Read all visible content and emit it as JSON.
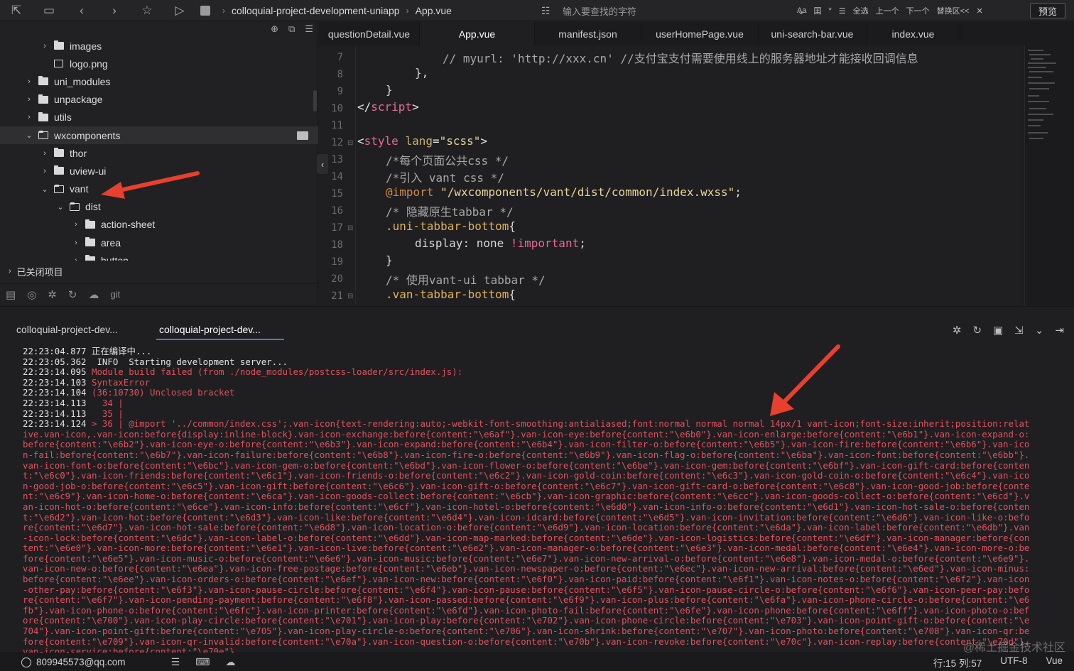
{
  "toolbar": {
    "breadcrumb": [
      "colloquial-project-development-uniapp",
      "App.vue"
    ],
    "search_placeholder": "输入要查找的字符",
    "find_tools": [
      "Aa",
      "囯",
      "*",
      "☰",
      "全选",
      "上一个",
      "下一个",
      "替换区<<",
      "✕"
    ],
    "preview": "预览"
  },
  "sidebar": {
    "tree": [
      {
        "label": "images",
        "depth": 2,
        "type": "folder",
        "expanded": false
      },
      {
        "label": "logo.png",
        "depth": 2,
        "type": "image",
        "expanded": false
      },
      {
        "label": "uni_modules",
        "depth": 1,
        "type": "folder",
        "expanded": false
      },
      {
        "label": "unpackage",
        "depth": 1,
        "type": "folder",
        "expanded": false
      },
      {
        "label": "utils",
        "depth": 1,
        "type": "folder",
        "expanded": false
      },
      {
        "label": "wxcomponents",
        "depth": 1,
        "type": "folder",
        "expanded": true,
        "selected": true
      },
      {
        "label": "thor",
        "depth": 2,
        "type": "folder",
        "expanded": false
      },
      {
        "label": "uview-ui",
        "depth": 2,
        "type": "folder",
        "expanded": false
      },
      {
        "label": "vant",
        "depth": 2,
        "type": "folder",
        "expanded": true
      },
      {
        "label": "dist",
        "depth": 3,
        "type": "folder",
        "expanded": true
      },
      {
        "label": "action-sheet",
        "depth": 4,
        "type": "folder",
        "expanded": false
      },
      {
        "label": "area",
        "depth": 4,
        "type": "folder",
        "expanded": false
      },
      {
        "label": "button",
        "depth": 4,
        "type": "folder",
        "expanded": false
      }
    ],
    "closed_projects": "已关闭项目",
    "bottom_icons": [
      "file-tree-icon",
      "binoculars-icon",
      "bug-icon",
      "sync-icon",
      "cloud-icon"
    ],
    "bottom_git": "git"
  },
  "tabs": [
    {
      "label": "questionDetail.vue",
      "active": false
    },
    {
      "label": "App.vue",
      "active": true
    },
    {
      "label": "manifest.json",
      "active": false
    },
    {
      "label": "userHomePage.vue",
      "active": false
    },
    {
      "label": "uni-search-bar.vue",
      "active": false
    },
    {
      "label": "index.vue",
      "active": false
    }
  ],
  "editor": {
    "lines": [
      {
        "n": "7",
        "fold": false
      },
      {
        "n": "8",
        "fold": false
      },
      {
        "n": "9",
        "fold": false
      },
      {
        "n": "10",
        "fold": false
      },
      {
        "n": "11",
        "fold": false
      },
      {
        "n": "12",
        "fold": true
      },
      {
        "n": "13",
        "fold": false
      },
      {
        "n": "14",
        "fold": false
      },
      {
        "n": "15",
        "fold": false
      },
      {
        "n": "16",
        "fold": false
      },
      {
        "n": "17",
        "fold": true
      },
      {
        "n": "18",
        "fold": false
      },
      {
        "n": "19",
        "fold": false
      },
      {
        "n": "20",
        "fold": false
      },
      {
        "n": "21",
        "fold": true
      }
    ],
    "code": {
      "l7": "// myurl: 'http://xxx.cn' //支付宝支付需要使用线上的服务器地址才能接收回调信息",
      "l8": "},",
      "l9": "}",
      "l10_open": "</",
      "l10_tag": "script",
      "l10_close": ">",
      "l12_open": "<",
      "l12_tag": "style",
      "l12_attr": " lang",
      "l12_eq": "=",
      "l12_val": "\"scss\"",
      "l12_close": ">",
      "l13": "/*每个页面公共css */",
      "l14": "/*引入 vant css */",
      "l15_at": "@import",
      "l15_str": " \"/wxcomponents/vant/dist/common/index.wxss\"",
      "l15_end": ";",
      "l16": "/* 隐藏原生tabbar */",
      "l17_sel": ".uni-tabbar-bottom",
      "l17_brace": "{",
      "l18_prop": "display",
      "l18_colon": ": none ",
      "l18_imp": "!important",
      "l18_end": ";",
      "l19": "}",
      "l20": "/* 使用vant-ui tabbar */",
      "l21_sel": ".van-tabbar-bottom",
      "l21_brace": "{"
    }
  },
  "console": {
    "tabs": [
      "colloquial-project-dev...",
      "colloquial-project-dev..."
    ],
    "active_tab": 1,
    "tool_icons": [
      "bug-icon",
      "restart-icon",
      "stop-icon",
      "export-icon",
      "chevron-down-icon",
      "close-split-icon"
    ],
    "logs": [
      {
        "ts": "22:23:04.877",
        "text": " 正在编译中...",
        "error": false
      },
      {
        "ts": "22:23:05.362",
        "text": "  INFO  Starting development server...",
        "error": false
      },
      {
        "ts": "22:23:14.095",
        "text": " Module build failed (from ./node_modules/postcss-loader/src/index.js):",
        "error": true
      },
      {
        "ts": "22:23:14.103",
        "text": " SyntaxError",
        "error": true
      },
      {
        "ts": "22:23:14.104",
        "text": " (36:10730) Unclosed bracket",
        "error": true
      },
      {
        "ts": "22:23:14.113",
        "text": "   34 |",
        "error": true
      },
      {
        "ts": "22:23:14.113",
        "text": "   35 |",
        "error": true
      }
    ],
    "dump_ts": "22:23:14.124",
    "dump": " > 36 | @import '../common/index.css';.van-icon{text-rendering:auto;-webkit-font-smoothing:antialiased;font:normal normal normal 14px/1 vant-icon;font-size:inherit;position:relative.van-icon,.van-icon:before{display:inline-block}.van-icon-exchange:before{content:\"\\e6af\"}.van-icon-eye:before{content:\"\\e6b0\"}.van-icon-enlarge:before{content:\"\\e6b1\"}.van-icon-expand-o:before{content:\"\\e6b2\"}.van-icon-eye-o:before{content:\"\\e6b3\"}.van-icon-expand:before{content:\"\\e6b4\"}.van-icon-filter-o:before{content:\"\\e6b5\"}.van-icon-fire:before{content:\"\\e6b6\"}.van-icon-fail:before{content:\"\\e6b7\"}.van-icon-failure:before{content:\"\\e6b8\"}.van-icon-fire-o:before{content:\"\\e6b9\"}.van-icon-flag-o:before{content:\"\\e6ba\"}.van-icon-font:before{content:\"\\e6bb\"}.van-icon-font-o:before{content:\"\\e6bc\"}.van-icon-gem-o:before{content:\"\\e6bd\"}.van-icon-flower-o:before{content:\"\\e6be\"}.van-icon-gem:before{content:\"\\e6bf\"}.van-icon-gift-card:before{content:\"\\e6c0\"}.van-icon-friends:before{content:\"\\e6c1\"}.van-icon-friends-o:before{content:\"\\e6c2\"}.van-icon-gold-coin:before{content:\"\\e6c3\"}.van-icon-gold-coin-o:before{content:\"\\e6c4\"}.van-icon-good-job-o:before{content:\"\\e6c5\"}.van-icon-gift:before{content:\"\\e6c6\"}.van-icon-gift-o:before{content:\"\\e6c7\"}.van-icon-gift-card-o:before{content:\"\\e6c8\"}.van-icon-good-job:before{content:\"\\e6c9\"}.van-icon-home-o:before{content:\"\\e6ca\"}.van-icon-goods-collect:before{content:\"\\e6cb\"}.van-icon-graphic:before{content:\"\\e6cc\"}.van-icon-goods-collect-o:before{content:\"\\e6cd\"}.van-icon-hot-o:before{content:\"\\e6ce\"}.van-icon-info:before{content:\"\\e6cf\"}.van-icon-hotel-o:before{content:\"\\e6d0\"}.van-icon-info-o:before{content:\"\\e6d1\"}.van-icon-hot-sale-o:before{content:\"\\e6d2\"}.van-icon-hot:before{content:\"\\e6d3\"}.van-icon-like:before{content:\"\\e6d4\"}.van-icon-idcard:before{content:\"\\e6d5\"}.van-icon-invitation:before{content:\"\\e6d6\"}.van-icon-like-o:before{content:\"\\e6d7\"}.van-icon-hot-sale:before{content:\"\\e6d8\"}.van-icon-location-o:before{content:\"\\e6d9\"}.van-icon-location:before{content:\"\\e6da\"}.van-icon-label:before{content:\"\\e6db\"}.van-icon-lock:before{content:\"\\e6dc\"}.van-icon-label-o:before{content:\"\\e6dd\"}.van-icon-map-marked:before{content:\"\\e6de\"}.van-icon-logistics:before{content:\"\\e6df\"}.van-icon-manager:before{content:\"\\e6e0\"}.van-icon-more:before{content:\"\\e6e1\"}.van-icon-live:before{content:\"\\e6e2\"}.van-icon-manager-o:before{content:\"\\e6e3\"}.van-icon-medal:before{content:\"\\e6e4\"}.van-icon-more-o:before{content:\"\\e6e5\"}.van-icon-music-o:before{content:\"\\e6e6\"}.van-icon-music:before{content:\"\\e6e7\"}.van-icon-new-arrival-o:before{content:\"\\e6e8\"}.van-icon-medal-o:before{content:\"\\e6e9\"}.van-icon-new-o:before{content:\"\\e6ea\"}.van-icon-free-postage:before{content:\"\\e6eb\"}.van-icon-newspaper-o:before{content:\"\\e6ec\"}.van-icon-new-arrival:before{content:\"\\e6ed\"}.van-icon-minus:before{content:\"\\e6ee\"}.van-icon-orders-o:before{content:\"\\e6ef\"}.van-icon-new:before{content:\"\\e6f0\"}.van-icon-paid:before{content:\"\\e6f1\"}.van-icon-notes-o:before{content:\"\\e6f2\"}.van-icon-other-pay:before{content:\"\\e6f3\"}.van-icon-pause-circle:before{content:\"\\e6f4\"}.van-icon-pause:before{content:\"\\e6f5\"}.van-icon-pause-circle-o:before{content:\"\\e6f6\"}.van-icon-peer-pay:before{content:\"\\e6f7\"}.van-icon-pending-payment:before{content:\"\\e6f8\"}.van-icon-passed:before{content:\"\\e6f9\"}.van-icon-plus:before{content:\"\\e6fa\"}.van-icon-phone-circle-o:before{content:\"\\e6fb\"}.van-icon-phone-o:before{content:\"\\e6fc\"}.van-icon-printer:before{content:\"\\e6fd\"}.van-icon-photo-fail:before{content:\"\\e6fe\"}.van-icon-phone:before{content:\"\\e6ff\"}.van-icon-photo-o:before{content:\"\\e700\"}.van-icon-play-circle:before{content:\"\\e701\"}.van-icon-play:before{content:\"\\e702\"}.van-icon-phone-circle:before{content:\"\\e703\"}.van-icon-point-gift-o:before{content:\"\\e704\"}.van-icon-point-gift:before{content:\"\\e705\"}.van-icon-play-circle-o:before{content:\"\\e706\"}.van-icon-shrink:before{content:\"\\e707\"}.van-icon-photo:before{content:\"\\e708\"}.van-icon-qr:before{content:\"\\e709\"}.van-icon-qr-invalid:before{content:\"\\e70a\"}.van-icon-question-o:before{content:\"\\e70b\"}.van-icon-revoke:before{content:\"\\e70c\"}.van-icon-replay:before{content:\"\\e70d\"}.van-icon-service:before{content:\"\\e70e\"}",
    "watermark": "@稀土掘金技术社区"
  },
  "status": {
    "user": "809945573@qq.com",
    "position": "行:15  列:57",
    "encoding": "UTF-8",
    "language": "Vue"
  },
  "colors": {
    "accent": "#3b7ddd",
    "error": "#e0525e",
    "arrow": "#e8402e"
  }
}
